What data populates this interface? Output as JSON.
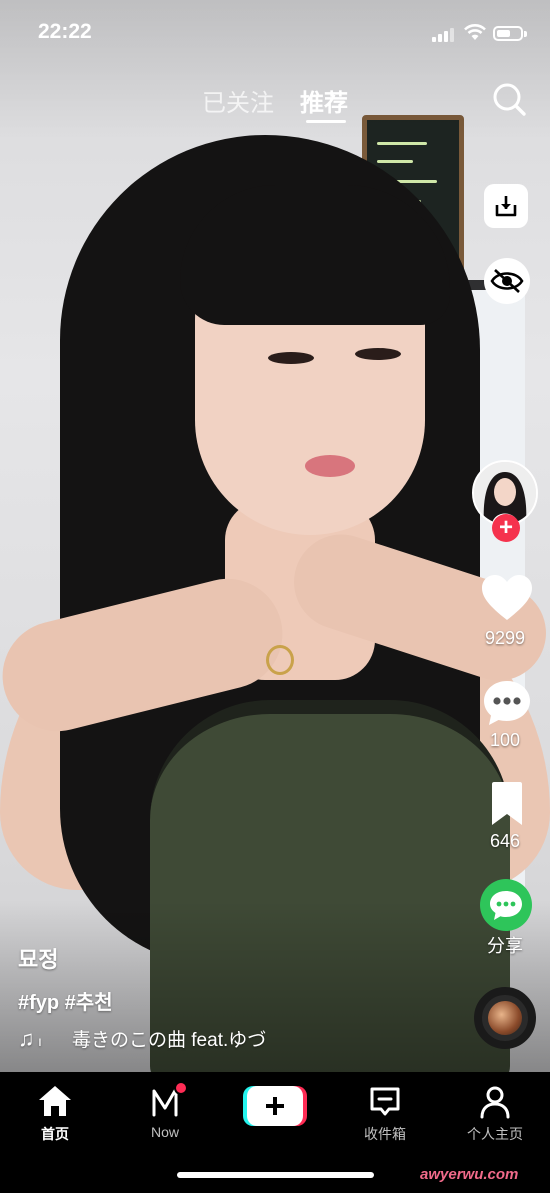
{
  "status_bar": {
    "time": "22:22"
  },
  "top_tabs": [
    {
      "label": "已关注",
      "active": false
    },
    {
      "label": "推荐",
      "active": true
    }
  ],
  "icons": {
    "search": "search-icon",
    "download": "download-icon",
    "hide": "eye-slash-icon",
    "like": "heart-icon",
    "comment": "comment-icon",
    "favorite": "bookmark-icon",
    "share": "share-icon"
  },
  "actions": {
    "likes": "9299",
    "comments": "100",
    "favorites": "646",
    "share_label": "分享"
  },
  "post": {
    "author": "묘정",
    "hashtags": "#fyp #추천",
    "music_note": "♫",
    "music_title": "毒きのこの曲 feat.ゆづ"
  },
  "bottom_nav": [
    {
      "label": "首页",
      "active": true
    },
    {
      "label": "Now",
      "active": false
    },
    {
      "label": "收件箱",
      "active": false
    },
    {
      "label": "个人主页",
      "active": false
    }
  ],
  "watermark": "awyerwu.com",
  "colors": {
    "accent_red": "#fe2c55",
    "accent_cyan": "#25f4ee",
    "share_green": "#2ec55a"
  }
}
